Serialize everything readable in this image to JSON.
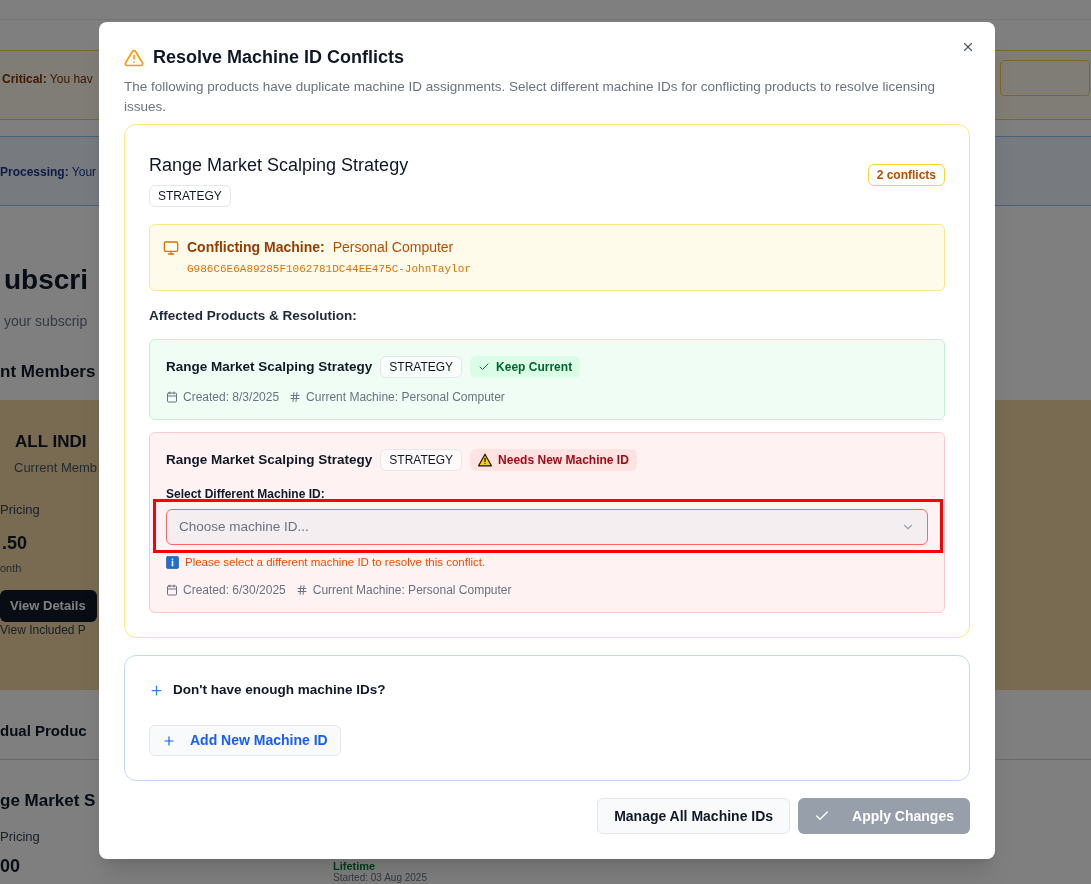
{
  "background": {
    "alert_critical": "**Critical:** You hav",
    "alert_processing": "**Processing:** Your",
    "page_title": "ubscri",
    "page_subtitle": "your subscrip",
    "section_membership": "nt Members",
    "membership_card": {
      "name": "ALL INDI",
      "subtitle": "Current Memb",
      "pricing_label": "Pricing",
      "price": ".50",
      "period": "onth",
      "details_button": "View Details",
      "included_link": "View Included P"
    },
    "section_products": "dual Produc",
    "product_card": {
      "name": "ge Market S",
      "pricing_label": "Pricing",
      "price": "00",
      "term": "Lifetime",
      "started": "Started: 03 Aug 2025"
    }
  },
  "dialog": {
    "title": "Resolve Machine ID Conflicts",
    "description": "The following products have duplicate machine ID assignments. Select different machine IDs for conflicting products to resolve licensing issues.",
    "conflict": {
      "product": "Range Market Scalping Strategy",
      "type": "STRATEGY",
      "count": "2 conflicts",
      "machine_label": "Conflicting Machine:",
      "machine_name": "Personal Computer",
      "machine_id": "G986C6E6A89285F1062781DC44EE475C-JohnTaylor",
      "affected_label": "Affected Products & Resolution:",
      "products": [
        {
          "kind": "keep",
          "name": "Range Market Scalping Strategy",
          "type": "STRATEGY",
          "status": "Keep Current",
          "created": "Created: 8/3/2025",
          "current_machine": "Current Machine: Personal Computer"
        },
        {
          "kind": "reassign",
          "name": "Range Market Scalping Strategy",
          "type": "STRATEGY",
          "status": "Needs New Machine ID",
          "select_label": "Select Different Machine ID:",
          "select_placeholder": "Choose machine ID...",
          "highlighted": true,
          "hint": "Please select a different machine ID to resolve this conflict.",
          "created": "Created: 6/30/2025",
          "current_machine": "Current Machine: Personal Computer"
        }
      ]
    },
    "more_ids": {
      "question": "Don't have enough machine IDs?",
      "add_button": "Add New Machine ID"
    },
    "buttons": [
      {
        "label": "Manage All Machine IDs",
        "kind": "secondary",
        "disabled": false
      },
      {
        "label": "Apply Changes",
        "kind": "primary",
        "disabled": true
      }
    ]
  }
}
